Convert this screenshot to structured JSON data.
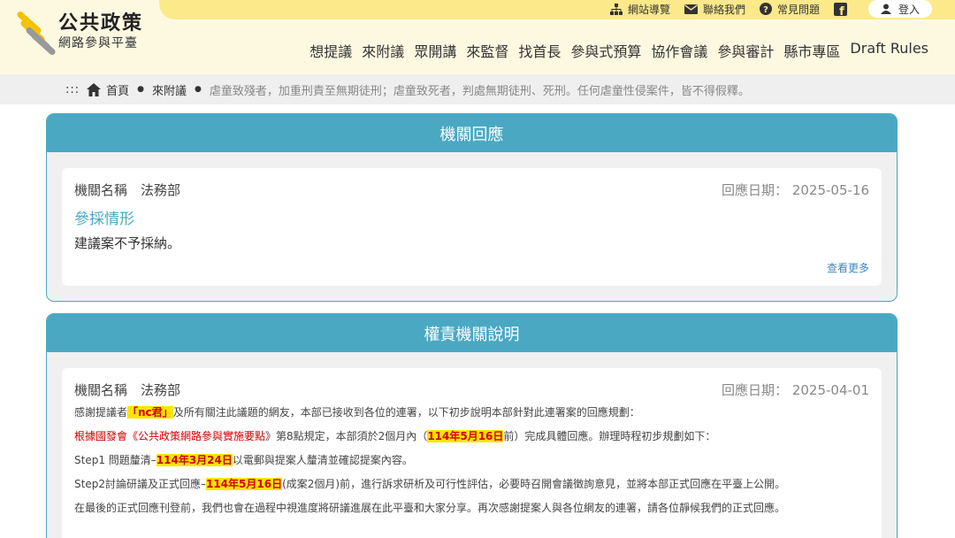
{
  "logo": {
    "line1": "公共政策",
    "line2": "網路參與平臺"
  },
  "utility": {
    "sitemap": "網站導覽",
    "contact": "聯絡我們",
    "faq": "常見問題",
    "login": "登入"
  },
  "nav": [
    "想提議",
    "來附議",
    "眾開講",
    "來監督",
    "找首長",
    "參與式預算",
    "協作會議",
    "參與審計",
    "縣市專區",
    "Draft Rules"
  ],
  "breadcrumb": {
    "dots": ":::",
    "home": "首頁",
    "section": "來附議",
    "current": "虐童致殘者，加重刑責至無期徒刑；虐童致死者，判處無期徒刑、死刑。任何虐童性侵案件，皆不得假釋。"
  },
  "response_panel": {
    "title": "機關回應",
    "agency_label": "機關名稱",
    "agency": "法務部",
    "date_label": "回應日期：",
    "date": "2025-05-16",
    "status_heading": "參採情形",
    "status_text": "建議案不予採納。",
    "more": "查看更多"
  },
  "explain_panel": {
    "title": "權責機關說明",
    "agency_label": "機關名稱",
    "agency": "法務部",
    "date_label": "回應日期：",
    "date": "2025-04-01",
    "l1a": "感謝提議者",
    "l1b": "「nc君」",
    "l1c": "及所有關注此議題的網友，本部已接收到各位的連署，以下初步說明本部針對此連署案的回應規劃：",
    "l2a": "根據國發會《",
    "l2b": "公共政策網路參與實施要點",
    "l2c": "》第8點規定，本部須於2個月內（",
    "l2d": "114年5月16日",
    "l2e": "前）完成具體回應。辦理時程初步規劃如下：",
    "l3a": "Step1 問題釐清–",
    "l3b": "114年3月24日",
    "l3c": "以電郵與提案人釐清並確認提案內容。",
    "l4a": "Step2討論研議及正式回應–",
    "l4b": "114年5月16日",
    "l4c": "(成案2個月)前，進行訴求研析及可行性評估，必要時召開會議徵詢意見，並將本部正式回應在平臺上公開。",
    "l5": "在最後的正式回應刊登前，我們也會在過程中視進度將研議進展在此平臺和大家分享。再次感謝提案人與各位網友的連署，請各位靜候我們的正式回應。"
  },
  "colors": {
    "accent": "#4aa8c3",
    "header_bg": "#fdf9e1",
    "top_strip": "#fbe98a",
    "highlight": "#fbe400",
    "alert": "#d00000"
  }
}
